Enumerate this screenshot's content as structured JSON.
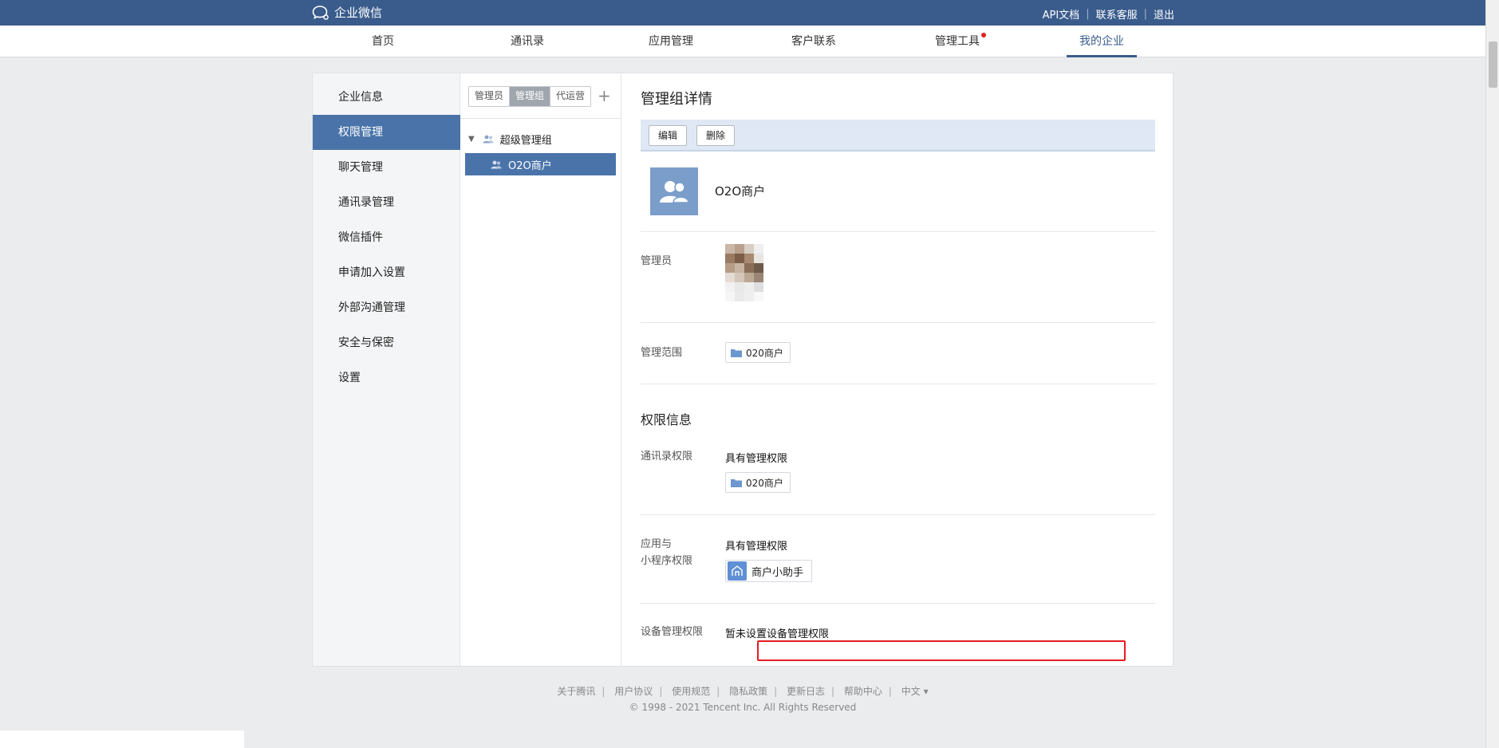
{
  "topbar": {
    "brand": "企业微信",
    "links": [
      "API文档",
      "联系客服",
      "退出"
    ]
  },
  "nav": {
    "items": [
      "首页",
      "通讯录",
      "应用管理",
      "客户联系",
      "管理工具",
      "我的企业"
    ],
    "active_index": 5,
    "reddot_on": "管理工具"
  },
  "sidebar": {
    "items": [
      "企业信息",
      "权限管理",
      "聊天管理",
      "通讯录管理",
      "微信插件",
      "申请加入设置",
      "外部沟通管理",
      "安全与保密",
      "设置"
    ],
    "active_index": 1
  },
  "midpanel": {
    "tabs": [
      "管理员",
      "管理组",
      "代运营"
    ],
    "active_tab": 1,
    "add_label": "+",
    "tree": {
      "root": "超级管理组",
      "selected": "O2O商户"
    }
  },
  "detail": {
    "heading": "管理组详情",
    "edit_label": "编辑",
    "delete_label": "删除",
    "group_name": "O2O商户",
    "admin_label": "管理员",
    "scope_label": "管理范围",
    "scope_value": "020商户",
    "perm_section": "权限信息",
    "contacts_perm_label": "通讯录权限",
    "contacts_perm_value": "具有管理权限",
    "contacts_perm_chip": "020商户",
    "app_perm_label_1": "应用与",
    "app_perm_label_2": "小程序权限",
    "app_perm_value": "具有管理权限",
    "app_perm_chip": "商户小助手",
    "device_perm_label": "设备管理权限",
    "device_perm_value": "暂未设置设备管理权限"
  },
  "footer": {
    "links": [
      "关于腾讯",
      "用户协议",
      "使用规范",
      "隐私政策",
      "更新日志",
      "帮助中心",
      "中文 ▾"
    ],
    "copyright": "© 1998 - 2021 Tencent Inc. All Rights Reserved"
  },
  "colors": {
    "topbar": "#3a5c8c",
    "accent": "#4a74a9",
    "highlight_box": "#e51c23",
    "reddot": "#e02020"
  }
}
